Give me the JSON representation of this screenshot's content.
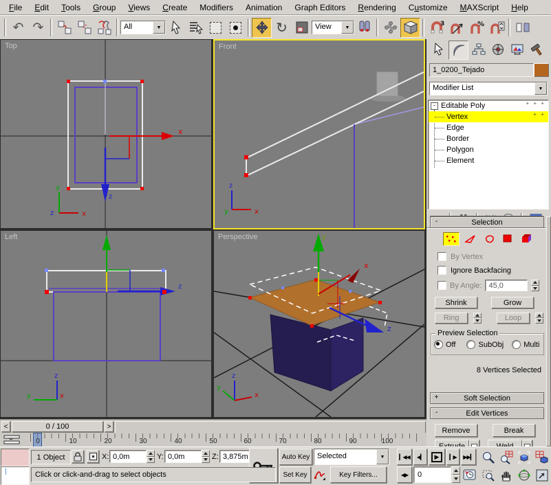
{
  "menu": {
    "items": [
      {
        "pre": "",
        "u": "F",
        "post": "ile"
      },
      {
        "pre": "",
        "u": "E",
        "post": "dit"
      },
      {
        "pre": "",
        "u": "T",
        "post": "ools"
      },
      {
        "pre": "",
        "u": "G",
        "post": "roup"
      },
      {
        "pre": "",
        "u": "V",
        "post": "iews"
      },
      {
        "pre": "",
        "u": "C",
        "post": "reate"
      },
      {
        "pre": "Modifiers",
        "u": "",
        "post": ""
      },
      {
        "pre": "Animation",
        "u": "",
        "post": ""
      },
      {
        "pre": "Graph Editors",
        "u": "",
        "post": ""
      },
      {
        "pre": "",
        "u": "R",
        "post": "endering"
      },
      {
        "pre": "C",
        "u": "u",
        "post": "stomize"
      },
      {
        "pre": "",
        "u": "M",
        "post": "AXScript"
      },
      {
        "pre": "",
        "u": "H",
        "post": "elp"
      }
    ]
  },
  "toolbar": {
    "filter_value": "All",
    "coord_value": "View"
  },
  "icons": {
    "undo": "↶",
    "redo": "↷",
    "rotate": "↻",
    "dropdown_arrow": "▼",
    "play": "▶",
    "prev_frame": "◀▎",
    "goto_start": "▎◀◀",
    "next_frame": "▎▶",
    "goto_end": "▶▶▎",
    "key_mode": "◀▶",
    "ts_prev": "<",
    "ts_next": ">",
    "minus": "-",
    "plus": "+"
  },
  "colors": {
    "accent_yellow": "#eec44e",
    "selection_highlight": "#ffff00",
    "viewport_bg": "#7d7d7d",
    "object_color": "#b4651e",
    "roof": "#b2702d",
    "house": "#251c4f",
    "active_viewport_border": "#f5e427"
  },
  "viewports": {
    "top": {
      "label": "Top",
      "tripod_v": "y",
      "tripod_h": "x",
      "tripod_c": "z",
      "gizmo_h": "x",
      "gizmo_v": "z"
    },
    "front": {
      "label": "Front",
      "tripod_v": "z",
      "tripod_h": "x",
      "tripod_c": "y"
    },
    "left": {
      "label": "Left",
      "tripod_v": "z",
      "tripod_h": "y",
      "tripod_c": "x",
      "gizmo_h": "z"
    },
    "perspective": {
      "label": "Perspective",
      "tripod_v": "z",
      "tripod_h": "x",
      "tripod_c": "y",
      "gizmo_v": "y",
      "gizmo_h": "x",
      "gizmo_d": "z"
    }
  },
  "command_panel": {
    "object_name": "1_0200_Tejado",
    "object_color": "#b4651e",
    "modifier_list": "Modifier List",
    "stack": {
      "root": "Editable Poly",
      "items": [
        "Vertex",
        "Edge",
        "Border",
        "Polygon",
        "Element"
      ],
      "selected": "Vertex"
    },
    "selection": {
      "title": "Selection",
      "by_vertex": "By Vertex",
      "ignore_backfacing": "Ignore Backfacing",
      "by_angle": "By Angle:",
      "by_angle_value": "45,0",
      "shrink": "Shrink",
      "grow": "Grow",
      "ring": "Ring",
      "loop": "Loop",
      "preview_title": "Preview Selection",
      "preview_options": [
        "Off",
        "SubObj",
        "Multi"
      ],
      "preview_selected": "Off",
      "status": "8 Vertices Selected"
    },
    "soft_selection": "Soft Selection",
    "edit_vertices": {
      "title": "Edit Vertices",
      "remove": "Remove",
      "break": "Break",
      "extrude": "Extrude",
      "weld": "Weld"
    }
  },
  "timeline": {
    "knob": "0 / 100",
    "ticks": [
      "0",
      "10",
      "20",
      "30",
      "40",
      "50",
      "60",
      "70",
      "80",
      "90",
      "100"
    ],
    "frame": "0"
  },
  "status_bar": {
    "object_count": "1 Object",
    "x_label": "X:",
    "y_label": "Y:",
    "z_label": "Z:",
    "x_value": "0,0m",
    "y_value": "0,0m",
    "z_value": "3,875m",
    "auto_key": "Auto Key",
    "set_key": "Set Key",
    "selection_set": "Selected",
    "key_filters": "Key Filters...",
    "prompt": "Click or click-and-drag to select objects"
  }
}
